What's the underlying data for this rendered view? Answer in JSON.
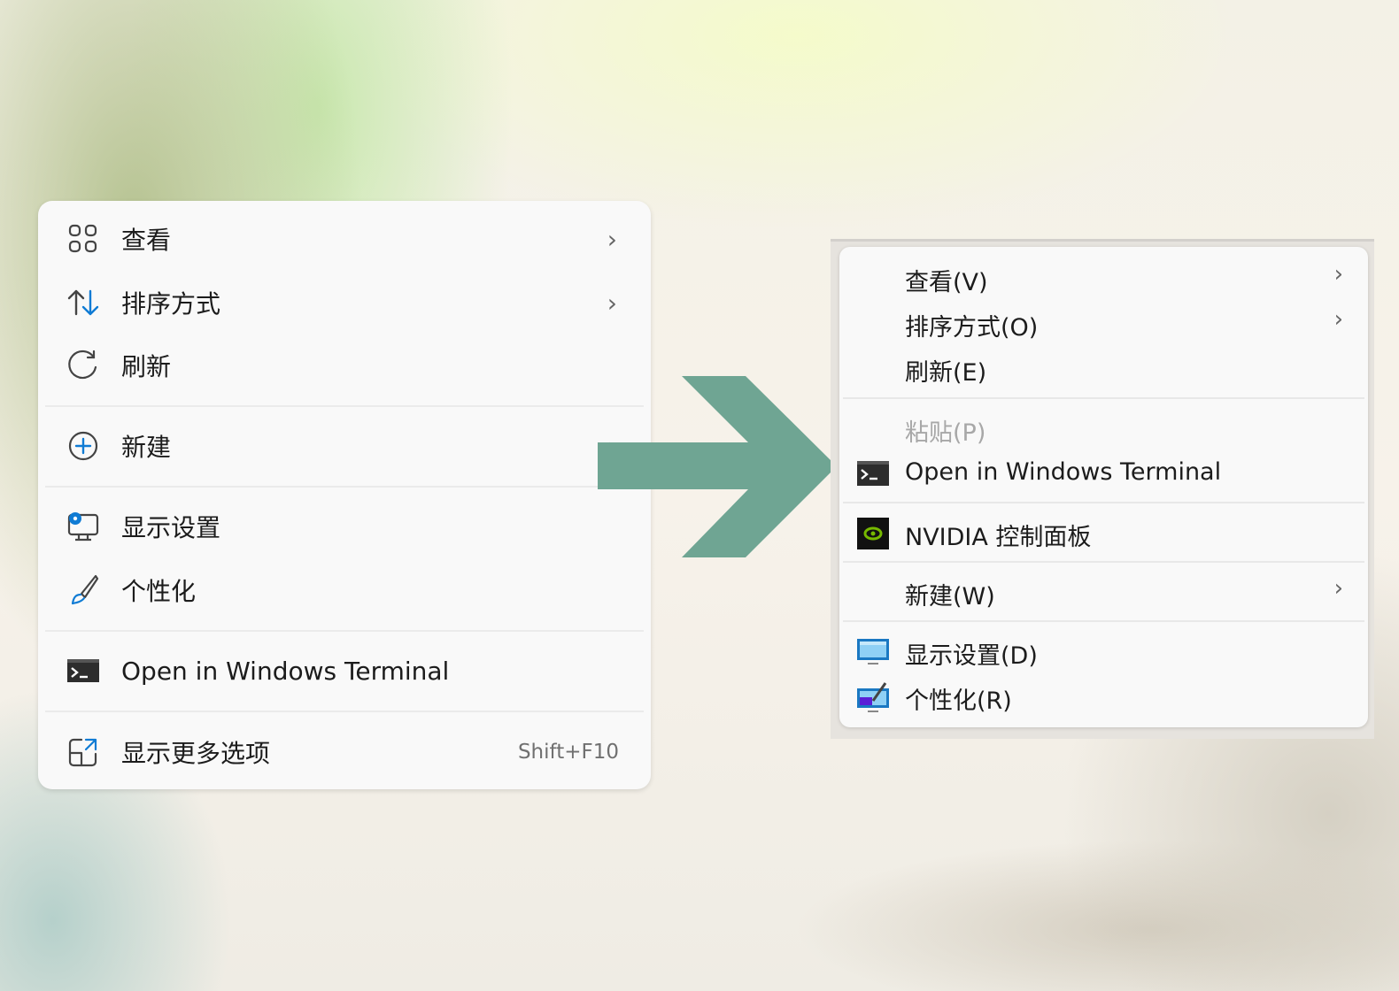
{
  "left_menu": {
    "items": [
      {
        "id": "view",
        "icon": "grid-icon",
        "label": "查看",
        "submenu": true
      },
      {
        "id": "sort",
        "icon": "sort-arrows-icon",
        "label": "排序方式",
        "submenu": true
      },
      {
        "id": "refresh",
        "icon": "refresh-icon",
        "label": "刷新",
        "submenu": false
      },
      {
        "id": "new",
        "icon": "add-circle-icon",
        "label": "新建",
        "submenu": true
      },
      {
        "id": "display",
        "icon": "display-settings-icon",
        "label": "显示设置",
        "submenu": false
      },
      {
        "id": "personalize",
        "icon": "brush-icon",
        "label": "个性化",
        "submenu": false
      },
      {
        "id": "terminal",
        "icon": "terminal-icon",
        "label": "Open in Windows Terminal",
        "submenu": false
      },
      {
        "id": "more",
        "icon": "show-more-icon",
        "label": "显示更多选项",
        "shortcut": "Shift+F10"
      }
    ],
    "chevron": "›"
  },
  "arrow": {
    "color": "#6fa593",
    "direction": "right"
  },
  "right_menu": {
    "items": [
      {
        "id": "view",
        "label": "查看(V)",
        "submenu": true
      },
      {
        "id": "sort",
        "label": "排序方式(O)",
        "submenu": true
      },
      {
        "id": "refresh",
        "label": "刷新(E)",
        "submenu": false
      },
      {
        "id": "paste",
        "label": "粘贴(P)",
        "disabled": true
      },
      {
        "id": "terminal",
        "icon": "terminal-icon",
        "label": "Open in Windows Terminal"
      },
      {
        "id": "nvidia",
        "icon": "nvidia-icon",
        "label": "NVIDIA 控制面板"
      },
      {
        "id": "new",
        "label": "新建(W)",
        "submenu": true
      },
      {
        "id": "display",
        "icon": "monitor-icon",
        "label": "显示设置(D)"
      },
      {
        "id": "personalize",
        "icon": "personalize-icon",
        "label": "个性化(R)"
      }
    ],
    "chevron": "›"
  },
  "colors": {
    "accent_blue": "#0067c0",
    "arrow_green": "#6fa593",
    "menu_bg": "#f9f9f9",
    "nvidia_green": "#76b900"
  }
}
